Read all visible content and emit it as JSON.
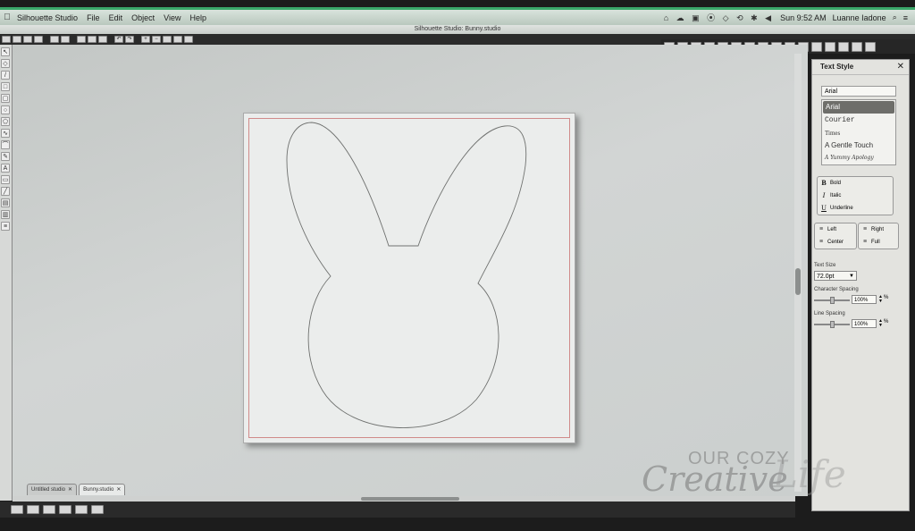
{
  "menubar": {
    "app": "Silhouette Studio",
    "menus": [
      "File",
      "Edit",
      "Object",
      "View",
      "Help"
    ],
    "clock": "Sun 9:52 AM",
    "user": "Luanne Iadone"
  },
  "window": {
    "title": "Silhouette Studio: Bunny.studio"
  },
  "tabs": [
    {
      "label": "Untitled studio"
    },
    {
      "label": "Bunny.studio"
    }
  ],
  "text_style": {
    "title": "Text Style",
    "font_input": "Arial",
    "fonts": [
      "Arial",
      "Courier",
      "Times",
      "A Gentle Touch",
      "A Yummy Apology"
    ],
    "selected_font": "Arial",
    "styles": {
      "bold": "Bold",
      "italic": "Italic",
      "underline": "Underline"
    },
    "align": {
      "left": "Left",
      "center": "Center",
      "right": "Right",
      "full": "Full"
    },
    "text_size_label": "Text Size",
    "text_size": "72.0pt",
    "char_spacing_label": "Character Spacing",
    "char_spacing": "100%",
    "line_spacing_label": "Line Spacing",
    "line_spacing": "100%",
    "percent": "%"
  },
  "watermark": {
    "line1": "OUR COZY",
    "line2": "Creative",
    "line3": "Life"
  }
}
